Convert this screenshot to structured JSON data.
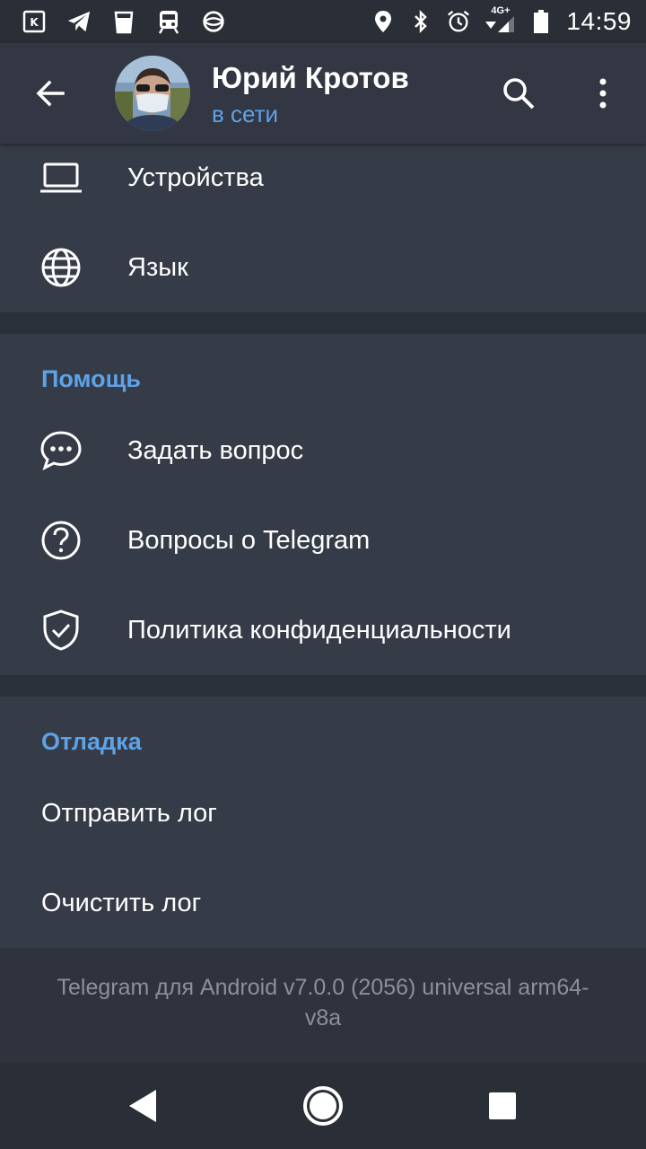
{
  "status_bar": {
    "time": "14:59",
    "network": "4G+",
    "left_icons": [
      "kinopoisk-icon",
      "telegram-icon",
      "cup-icon",
      "train-icon",
      "sports-icon"
    ],
    "right_icons": [
      "location-icon",
      "bluetooth-icon",
      "alarm-icon",
      "signal-icon",
      "battery-icon"
    ]
  },
  "header": {
    "name": "Юрий Кротов",
    "status": "в сети"
  },
  "settings_top": {
    "items": [
      {
        "label": "Устройства",
        "icon": "laptop-icon"
      },
      {
        "label": "Язык",
        "icon": "globe-icon"
      }
    ]
  },
  "help": {
    "title": "Помощь",
    "items": [
      {
        "label": "Задать вопрос",
        "icon": "chat-icon"
      },
      {
        "label": "Вопросы о Telegram",
        "icon": "question-icon"
      },
      {
        "label": "Политика конфиденциальности",
        "icon": "shield-check-icon"
      }
    ]
  },
  "debug": {
    "title": "Отладка",
    "items": [
      {
        "label": "Отправить лог"
      },
      {
        "label": "Очистить лог"
      }
    ]
  },
  "footer": {
    "version": "Telegram для Android v7.0.0 (2056) universal arm64-v8a"
  },
  "colors": {
    "accent": "#5ea2e8",
    "background": "#363b48",
    "app_bar": "#323743"
  }
}
